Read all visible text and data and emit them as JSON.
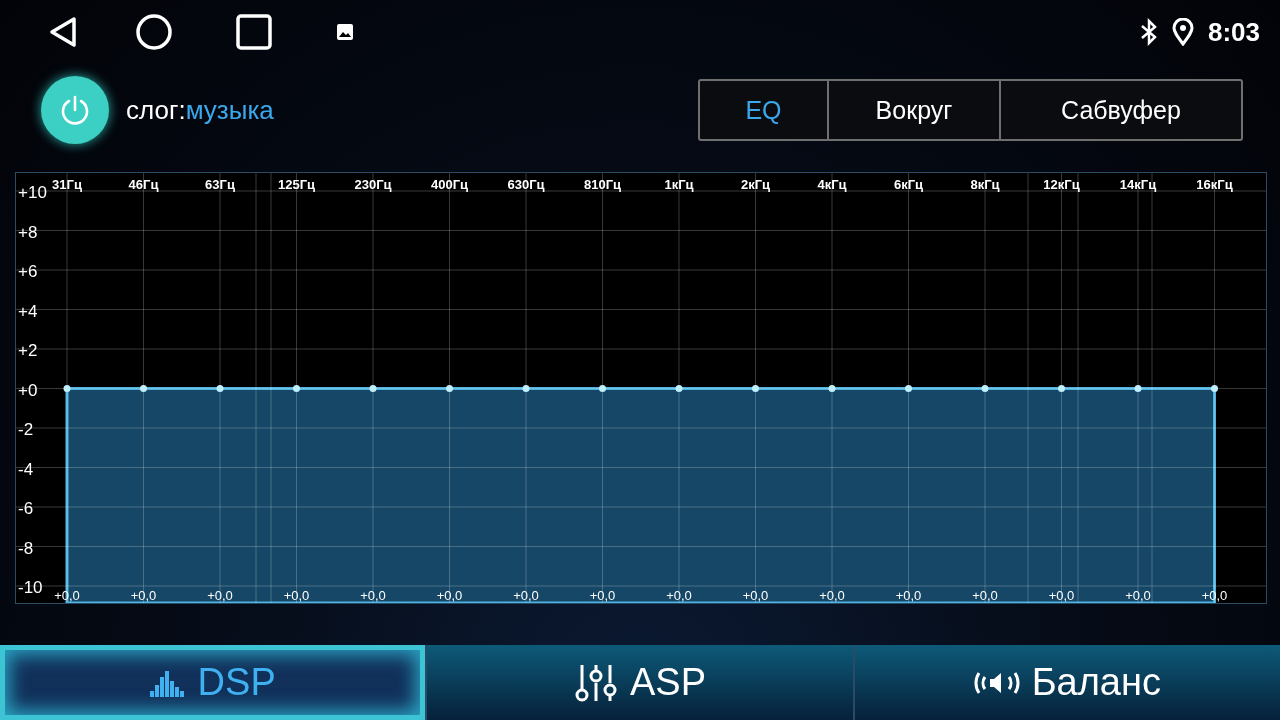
{
  "status_bar": {
    "time": "8:03"
  },
  "preset": {
    "on": true,
    "label": "слог:",
    "value": "музыка"
  },
  "mode_tabs": [
    {
      "label": "EQ",
      "selected": true
    },
    {
      "label": "Вокруг",
      "selected": false
    },
    {
      "label": "Сабвуфер",
      "selected": false
    }
  ],
  "equalizer": {
    "chart_data": {
      "type": "area",
      "categories": [
        "31Гц",
        "46Гц",
        "63Гц",
        "125Гц",
        "230Гц",
        "400Гц",
        "630Гц",
        "810Гц",
        "1кГц",
        "2кГц",
        "4кГц",
        "6кГц",
        "8кГц",
        "12кГц",
        "14кГц",
        "16кГц"
      ],
      "values": [
        0,
        0,
        0,
        0,
        0,
        0,
        0,
        0,
        0,
        0,
        0,
        0,
        0,
        0,
        0,
        0
      ],
      "ylim": [
        -10,
        10
      ],
      "grid": true,
      "yticks": [
        {
          "value": 10,
          "label": "+10"
        },
        {
          "value": 8,
          "label": "+8"
        },
        {
          "value": 6,
          "label": "+6"
        },
        {
          "value": 4,
          "label": "+4"
        },
        {
          "value": 2,
          "label": "+2"
        },
        {
          "value": 0,
          "label": "+0"
        },
        {
          "value": -2,
          "label": "-2"
        },
        {
          "value": -4,
          "label": "-4"
        },
        {
          "value": -6,
          "label": "-6"
        },
        {
          "value": -8,
          "label": "-8"
        },
        {
          "value": -10,
          "label": "-10"
        }
      ],
      "value_labels": [
        "+0,0",
        "+0,0",
        "+0,0",
        "+0,0",
        "+0,0",
        "+0,0",
        "+0,0",
        "+0,0",
        "+0,0",
        "+0,0",
        "+0,0",
        "+0,0",
        "+0,0",
        "+0,0",
        "+0,0",
        "+0,0"
      ]
    }
  },
  "bottom_tabs": [
    {
      "kind": "dsp",
      "label": "DSP",
      "selected": true
    },
    {
      "kind": "asp",
      "label": "ASP",
      "selected": false
    },
    {
      "kind": "balance",
      "label": "Баланс",
      "selected": false
    }
  ]
}
